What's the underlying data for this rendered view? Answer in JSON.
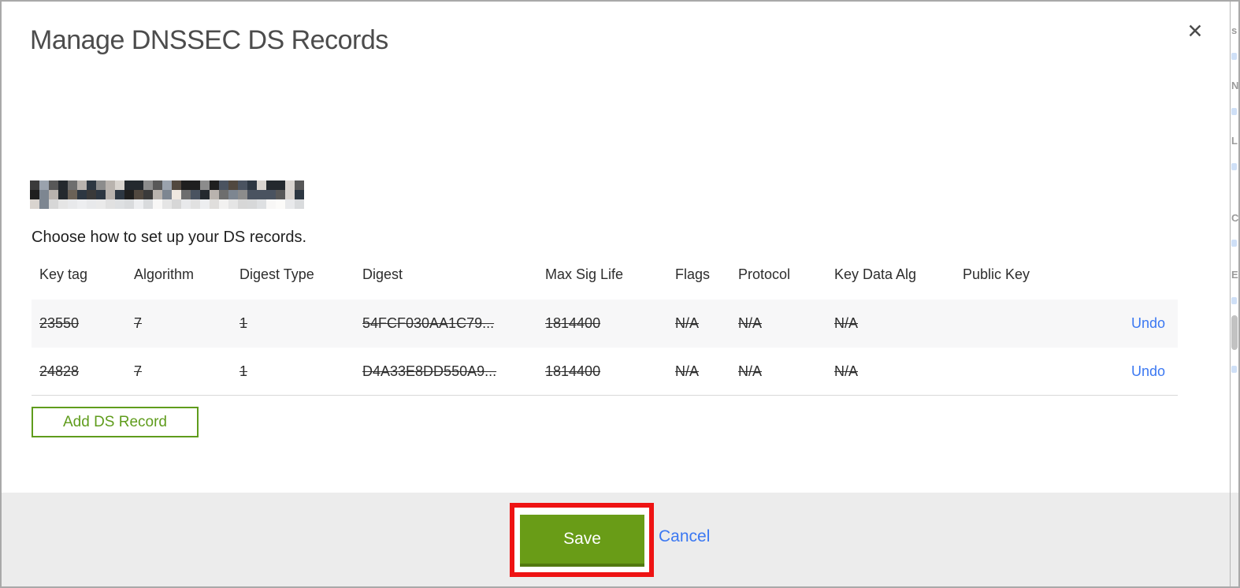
{
  "dialog": {
    "title": "Manage DNSSEC DS Records",
    "close_icon": "✕",
    "subtitle": "Choose how to set up your DS records.",
    "domain_redacted": true
  },
  "table": {
    "headers": [
      "Key tag",
      "Algorithm",
      "Digest Type",
      "Digest",
      "Max Sig Life",
      "Flags",
      "Protocol",
      "Key Data Alg",
      "Public Key"
    ],
    "rows": [
      {
        "key_tag": "23550",
        "algorithm": "7",
        "digest_type": "1",
        "digest": "54FCF030AA1C79...",
        "max_sig_life": "1814400",
        "flags": "N/A",
        "protocol": "N/A",
        "key_data_alg": "N/A",
        "public_key": "",
        "action": "Undo",
        "struck": true
      },
      {
        "key_tag": "24828",
        "algorithm": "7",
        "digest_type": "1",
        "digest": "D4A33E8DD550A9...",
        "max_sig_life": "1814400",
        "flags": "N/A",
        "protocol": "N/A",
        "key_data_alg": "N/A",
        "public_key": "",
        "action": "Undo",
        "struck": true
      }
    ]
  },
  "actions": {
    "add_record": "Add DS Record",
    "save": "Save",
    "cancel": "Cancel"
  },
  "colors": {
    "accent_green": "#699c17",
    "outline_green": "#5f9c1c",
    "link_blue": "#3b78f2",
    "annotation_red": "#ee1313",
    "footer_gray": "#ececec"
  },
  "background_fragments": [
    "s",
    "N",
    "L",
    "C",
    "E"
  ]
}
